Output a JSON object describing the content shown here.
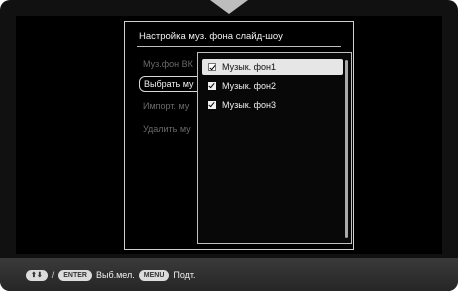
{
  "dialog": {
    "title": "Настройка муз. фона слайд-шоу",
    "menu": [
      {
        "label": "Муз.фон ВК",
        "state": "disabled"
      },
      {
        "label": "Выбрать му",
        "state": "active"
      },
      {
        "label": "Импорт. му",
        "state": "disabled"
      },
      {
        "label": "Удалить му",
        "state": "disabled"
      }
    ]
  },
  "submenu": {
    "items": [
      {
        "label": "Музык. фон1",
        "checked": true,
        "selected": true
      },
      {
        "label": "Музык. фон2",
        "checked": true,
        "selected": false
      },
      {
        "label": "Музык. фон3",
        "checked": true,
        "selected": false
      }
    ]
  },
  "footer": {
    "dpad_label": "⬆⬇",
    "slash": "/",
    "enter_key": "ENTER",
    "enter_action": "Выб.мел.",
    "menu_key": "MENU",
    "menu_action": "Подт."
  }
}
